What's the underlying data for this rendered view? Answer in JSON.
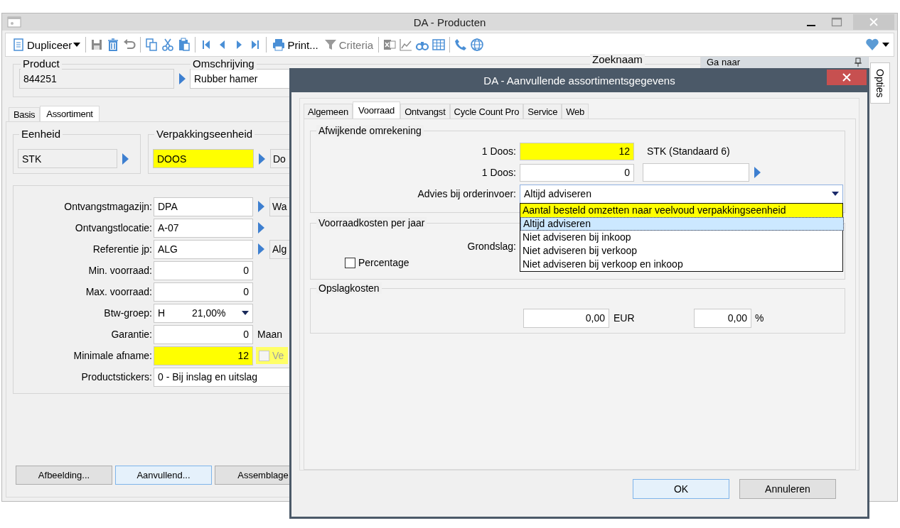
{
  "main_window": {
    "title": "DA - Producten",
    "toolbar": {
      "duplicate_label": "Dupliceer",
      "print_label": "Print...",
      "criteria": {
        "label": "Criteria",
        "disabled": true
      }
    },
    "header": {
      "product": {
        "label": "Product",
        "value": "844251"
      },
      "description": {
        "label": "Omschrijving",
        "value": "Rubber hamer"
      },
      "search_name_label": "Zoeknaam"
    },
    "tabs": [
      {
        "label": "Basis",
        "selected": false
      },
      {
        "label": "Assortiment",
        "selected": true
      }
    ],
    "unit": {
      "label": "Eenheid",
      "value": "STK"
    },
    "packaging_unit": {
      "label": "Verpakkingseenheid",
      "value": "DOOS",
      "highlighted": true,
      "side_value": "Do"
    },
    "fields": [
      {
        "kind": "lookup",
        "label": "Ontvangstmagazijn:",
        "value": "DPA",
        "side_value": "Wa"
      },
      {
        "kind": "lookup",
        "label": "Ontvangstlocatie:",
        "value": "A-07"
      },
      {
        "kind": "lookup",
        "label": "Referentie jp:",
        "value": "ALG",
        "side_value": "Alg"
      },
      {
        "kind": "number",
        "label": "Min. voorraad:",
        "value": "0"
      },
      {
        "kind": "number",
        "label": "Max. voorraad:",
        "value": "0"
      },
      {
        "kind": "select",
        "label": "Btw-groep:",
        "value": "H",
        "value_2": "21,00%"
      },
      {
        "kind": "number",
        "label": "Garantie:",
        "value": "0",
        "suffix": "Maan"
      },
      {
        "kind": "number",
        "label": "Minimale afname:",
        "value": "12",
        "highlighted": true,
        "checkbox": {
          "label": "Ve",
          "checked": false,
          "disabled": true
        }
      },
      {
        "kind": "text",
        "label": "Productstickers:",
        "value": "0 -  Bij inslag en uitslag"
      }
    ],
    "buttons": [
      {
        "label": "Afbeelding...",
        "default": false
      },
      {
        "label": "Aanvullend...",
        "default": true
      },
      {
        "label": "Assemblage",
        "default": false
      }
    ],
    "side_panel": {
      "title": "Ga naar",
      "tab": "Opties"
    }
  },
  "dialog": {
    "title": "DA - Aanvullende assortimentsgegevens",
    "tabs": [
      {
        "label": "Algemeen",
        "selected": false
      },
      {
        "label": "Voorraad",
        "selected": true
      },
      {
        "label": "Ontvangst",
        "selected": false
      },
      {
        "label": "Cycle Count Pro",
        "selected": false
      },
      {
        "label": "Service",
        "selected": false
      },
      {
        "label": "Web",
        "selected": false
      }
    ],
    "conversion": {
      "title": "Afwijkende omrekening",
      "rows": [
        {
          "label": "1 Doos:",
          "value": "12",
          "highlighted": true,
          "unit": "STK (Standaard 6)",
          "lookup": false
        },
        {
          "label": "1 Doos:",
          "value": "0",
          "highlighted": false,
          "lookup": true
        }
      ],
      "advice": {
        "label": "Advies bij orderinvoer:",
        "value": "Altijd adviseren",
        "expanded": true,
        "options": [
          {
            "label": "Aantal besteld omzetten naar veelvoud verpakkingseenheid",
            "selected": false,
            "highlighted": true
          },
          {
            "label": "Altijd adviseren",
            "selected": true,
            "highlighted": false
          },
          {
            "label": "Niet adviseren bij inkoop",
            "selected": false,
            "highlighted": false
          },
          {
            "label": "Niet adviseren bij verkoop",
            "selected": false,
            "highlighted": false
          },
          {
            "label": "Niet adviseren bij verkoop en inkoop",
            "selected": false,
            "highlighted": false
          }
        ]
      }
    },
    "stock_costs": {
      "title": "Voorraadkosten per jaar",
      "basis_label": "Grondslag:",
      "percentage": {
        "label": "Percentage",
        "checked": false
      }
    },
    "storage_costs": {
      "title": "Opslagkosten",
      "amount": "0,00",
      "currency": "EUR",
      "percent": "0,00",
      "percent_sign": "%"
    },
    "buttons": [
      {
        "label": "OK",
        "default": true
      },
      {
        "label": "Annuleren",
        "default": false
      }
    ]
  }
}
